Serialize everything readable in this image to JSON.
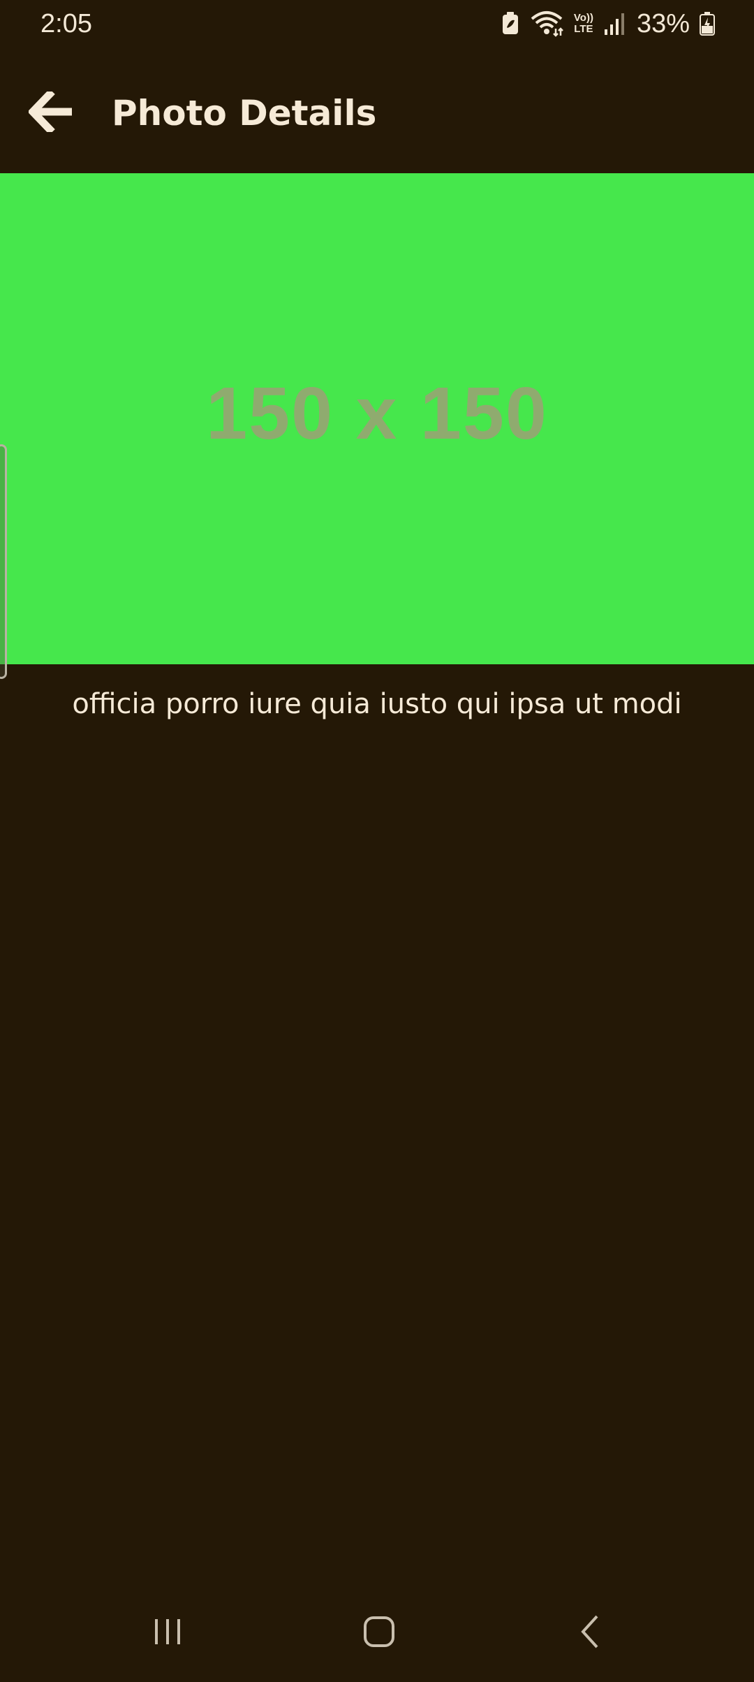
{
  "status_bar": {
    "time": "2:05",
    "battery_percent": "33%",
    "icons": [
      "battery-saver-icon",
      "wifi-icon",
      "volte-icon",
      "signal-icon",
      "battery-icon"
    ],
    "volte_top": "Vo))",
    "volte_bottom": "LTE"
  },
  "app_bar": {
    "title": "Photo Details",
    "back_icon": "arrow-left-icon"
  },
  "photo": {
    "placeholder_text": "150 x 150",
    "background_color": "#46e74c",
    "text_color": "#8fab6f",
    "caption": "officia porro iure quia iusto qui ipsa ut modi"
  },
  "nav_bar": {
    "icons": [
      "recent-apps-icon",
      "home-icon",
      "back-icon"
    ]
  },
  "colors": {
    "background": "#241806",
    "foreground": "#f6ead7"
  }
}
